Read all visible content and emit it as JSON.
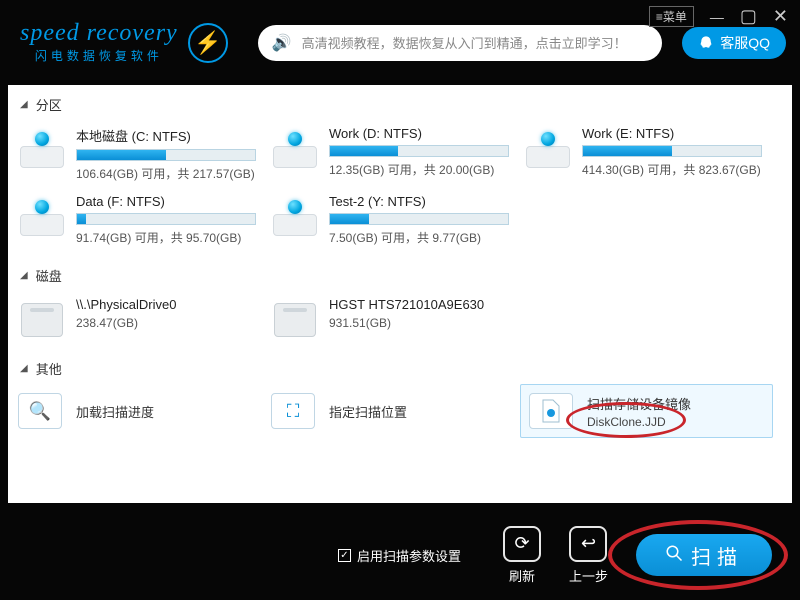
{
  "header": {
    "logo_main": "speed recovery",
    "logo_sub": "闪电数据恢复软件",
    "banner": "高清视频教程，数据恢复从入门到精通，点击立即学习！",
    "qq_label": "客服QQ",
    "menu_label": "菜单"
  },
  "sections": {
    "partitions_title": "分区",
    "disks_title": "磁盘",
    "other_title": "其他"
  },
  "partitions": [
    {
      "title": "本地磁盘 (C: NTFS)",
      "sub": "106.64(GB) 可用，共 217.57(GB)",
      "fill_pct": 50
    },
    {
      "title": "Work (D: NTFS)",
      "sub": "12.35(GB) 可用，共 20.00(GB)",
      "fill_pct": 38
    },
    {
      "title": "Work (E: NTFS)",
      "sub": "414.30(GB) 可用，共 823.67(GB)",
      "fill_pct": 50
    },
    {
      "title": "Data (F: NTFS)",
      "sub": "91.74(GB) 可用，共 95.70(GB)",
      "fill_pct": 5
    },
    {
      "title": "Test-2 (Y: NTFS)",
      "sub": "7.50(GB) 可用，共 9.77(GB)",
      "fill_pct": 22
    }
  ],
  "disks": [
    {
      "title": "\\\\.\\PhysicalDrive0",
      "sub": "238.47(GB)"
    },
    {
      "title": "HGST HTS721010A9E630",
      "sub": "931.51(GB)"
    }
  ],
  "other": {
    "load_progress": "加载扫描进度",
    "set_location": "指定扫描位置",
    "scan_image": "扫描存储设备镜像",
    "scan_image_file": "DiskClone.JJD"
  },
  "footer": {
    "param_label": "启用扫描参数设置",
    "refresh": "刷新",
    "back": "上一步",
    "scan": "扫描"
  }
}
